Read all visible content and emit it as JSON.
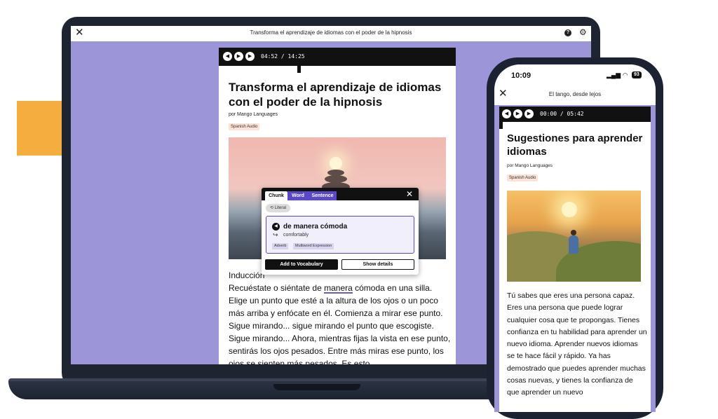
{
  "laptop": {
    "window_title": "Transforma el aprendizaje de idiomas con el poder de la hipnosis",
    "close_glyph": "✕",
    "help_glyph": "?",
    "gear_glyph": "⚙",
    "player": {
      "rewind_glyph": "◀",
      "play_glyph": "▶",
      "forward_glyph": "▶",
      "time": "04:52 / 14:25"
    },
    "title": "Transforma el aprendizaje de idiomas con el poder de la hipnosis",
    "byline": "por Mango Languages",
    "badge": "Spanish Audio",
    "body": {
      "line1": "Inducción",
      "line2_before": "Recuéstate o siéntate de ",
      "line2_highlight": "manera",
      "line2_after": " cómoda en una silla.",
      "rest": "Elige un punto que esté a la altura de los ojos o un poco más arriba y enfócate en él. Comienza a mirar ese punto. Sigue mirando... sigue mirando el punto que escogiste. Sigue mirando... Ahora, mientras fijas la vista en ese punto, sentirás los ojos pesados. Entre más miras ese punto, los ojos se sienten más pesados. Es esto"
    },
    "popup": {
      "tab_chunk": "Chunk",
      "tab_word": "Word",
      "tab_sentence": "Sentence",
      "close_glyph": "✕",
      "literal": "Literal",
      "phrase": "de manera cómoda",
      "translation": "comfortably",
      "tags": [
        "Adverb",
        "Multiword Expression"
      ],
      "add_button": "Add to Vocabulary",
      "details_button": "Show details"
    }
  },
  "phone": {
    "status_time": "10:09",
    "battery": "93",
    "window_title": "El tango, desde lejos",
    "close_glyph": "✕",
    "player": {
      "rewind_glyph": "◀",
      "play_glyph": "▶",
      "forward_glyph": "▶",
      "time": "00:00 / 05:42"
    },
    "title": "Sugestiones para aprender idiomas",
    "byline": "por Mango Languages",
    "badge": "Spanish Audio",
    "body": "Tú sabes que eres una persona capaz. Eres una persona que puede lograr cualquier cosa que te propongas. Tienes confianza en tu habilidad para aprender un nuevo idioma. Aprender nuevos idiomas se te hace fácil y rápido. Ya has demostrado que puedes aprender muchas cosas nuevas, y tienes la confianza de que aprender un nuevo"
  },
  "colors": {
    "accent_purple": "#5a48c8",
    "background_lavender": "#9c95d8",
    "decor_orange": "#f6ad3f"
  }
}
